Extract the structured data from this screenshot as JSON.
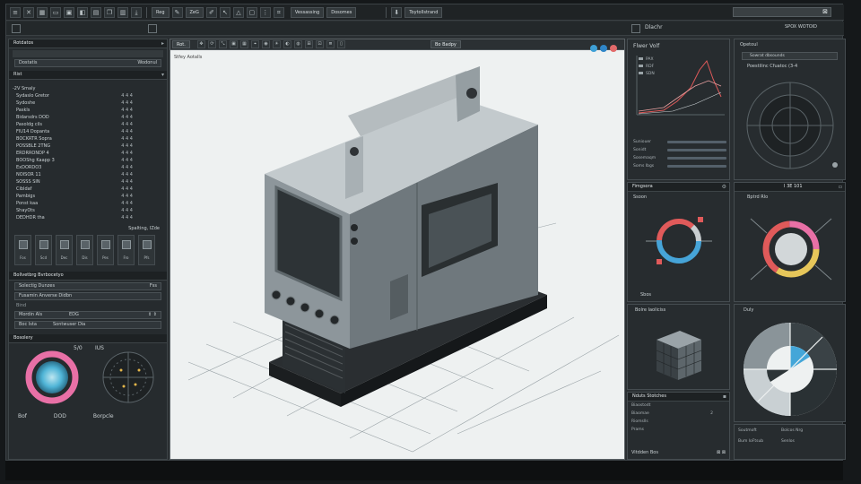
{
  "toolbar": {
    "label_a": "Reg",
    "label_b": "ZeG",
    "label_c": "Vessassing",
    "label_d": "Dosomes",
    "label_e": "Toytollstrand",
    "search_value": ""
  },
  "left": {
    "header_title": "Rotdatos",
    "field_a_label": "Dostatis",
    "field_a_value": "Wodonul",
    "section_b": "Rist",
    "section_c": "-2V Smaly",
    "rows": [
      {
        "label": "Sydaslo Gretor",
        "value": "4 4 4"
      },
      {
        "label": "Sydoshe",
        "value": "4 4 4"
      },
      {
        "label": "Paskls",
        "value": "4 4 4"
      },
      {
        "label": "Bidarsdrs DOD",
        "value": "4 4 4"
      },
      {
        "label": "Pasoldg cils",
        "value": "4 4 4"
      },
      {
        "label": "FlU14 Dopanta",
        "value": "4 4 4"
      },
      {
        "label": "BOCKRTR Sopra",
        "value": "4 4 4"
      },
      {
        "label": "POSSBLE 2TNG",
        "value": "4 4 4"
      },
      {
        "label": "ERDRRONDP 4",
        "value": "4 4 4"
      },
      {
        "label": "BOOShg Kaapp 3",
        "value": "4 4 4"
      },
      {
        "label": "ExDORDO3",
        "value": "4 4 4"
      },
      {
        "label": "NOISOR 11",
        "value": "4 4 4"
      },
      {
        "label": "SOSSS SIN",
        "value": "4 4 4"
      },
      {
        "label": "Cibldaf",
        "value": "4 4 4"
      },
      {
        "label": "Pambigs",
        "value": "4 4 4"
      },
      {
        "label": "Ponst kaa",
        "value": "4 4 4"
      },
      {
        "label": "ShayOts",
        "value": "4 4 4"
      },
      {
        "label": "DEDHDR tha",
        "value": "4 4 4"
      }
    ],
    "toolbar_note": "Spalting, IZde",
    "icons": [
      "Fos",
      "Scd",
      "Dec",
      "Dis",
      "Pes",
      "Fro",
      "Pfs"
    ],
    "section_d": "Bollvetbrg Bvrbocetyo",
    "field_b_label": "Solectig Dunzes",
    "field_b_value": "Fss",
    "field_c_label": "Fusamin Anverse Didbn",
    "sub_label": "Bind",
    "slider_a_label": "Mordin Als",
    "slider_a_value": "EDG",
    "slider_b_label": "Boc Ista",
    "slider_b_value": "Sontwuser Dia",
    "section_e": "Bosolery",
    "dial_label_a": "5/0",
    "dial_label_b": "IUS",
    "footer_a": "Bof",
    "footer_b": "DOD",
    "footer_c": "Borpcle"
  },
  "viewport": {
    "tab_a": "Rot.",
    "tab_b": "Bo Badpy",
    "label": "Stfey Aotalls",
    "dot_colors": [
      "#3ea0d6",
      "#2f86c8",
      "#e26a6a"
    ]
  },
  "right": {
    "p1_title": "Dlachr",
    "p1_sub": "Flwer Volf",
    "p1_legend": [
      "PAX",
      "RDF",
      "SDN"
    ],
    "p1_rows": [
      {
        "label": "Suniouer",
        "value": ""
      },
      {
        "label": "Sonidt",
        "value": ""
      },
      {
        "label": "Sosemaqm",
        "value": ""
      },
      {
        "label": "Soms Ibgs",
        "value": ""
      }
    ],
    "p2_title": "Opetoul",
    "p2_btn": "Sowrat dbsounds",
    "p2_sub": "Poestilinc Cfuatoc (3-4",
    "head_right": "SPOX WOTOID",
    "p3_title": "Fimgsora",
    "p3_sub": "Ssoon",
    "p3_badge": "Sbos",
    "p4_title": "I 3E 101",
    "p4_sub": "Bptrd Rlo",
    "p5_title": "Bolre Iaoliciss",
    "p6_title": "Duly",
    "p7_title": "Nduts Stotches",
    "p7_rows": [
      {
        "label": "Biaostodt",
        "value": ""
      },
      {
        "label": "Biaomae",
        "value": "2"
      },
      {
        "label": "Riomslls",
        "value": ""
      },
      {
        "label": "Prams",
        "value": ""
      }
    ],
    "p7_footer": "Vitdden Bos",
    "p8_rows": [
      {
        "label": "Soutmoft",
        "value": "Bolcos Nrg"
      },
      {
        "label": "Bum loFtsub",
        "value": "Senlos"
      }
    ]
  },
  "colors": {
    "accent_red": "#e05a5a",
    "accent_blue": "#46a4d8",
    "ring_yellow": "#e6c65a",
    "ring_pink": "#e870a6"
  }
}
